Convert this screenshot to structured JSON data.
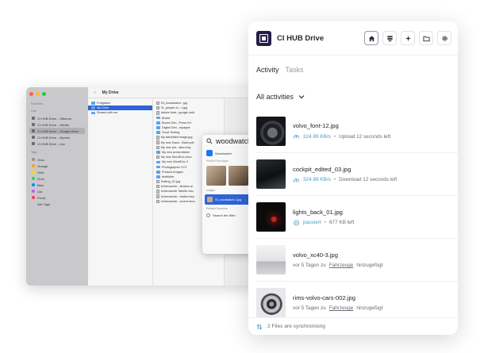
{
  "finder": {
    "toolbar_title": "My Drive",
    "sidebar": {
      "favorites_heading": "Favoriten",
      "locations_heading": "Orte",
      "tags_heading": "Tags",
      "locations": [
        "CI HUB Drive – Sitecore",
        "CI HUB Drive – Wedia",
        "CI HUB Drive – Google Drive",
        "CI HUB Drive – Bynder",
        "CI HUB Drive – box"
      ],
      "tags": [
        {
          "label": "Grau",
          "color": "#8e8e93"
        },
        {
          "label": "Orange",
          "color": "#ff9f0a"
        },
        {
          "label": "Gelb",
          "color": "#ffd60a"
        },
        {
          "label": "Grün",
          "color": "#30d158"
        },
        {
          "label": "Blau",
          "color": "#0a84ff"
        },
        {
          "label": "Lila",
          "color": "#bf5af2"
        },
        {
          "label": "Privat",
          "color": "#ff375f"
        },
        {
          "label": "Alle Tags",
          "color": "#c7c7cc"
        }
      ]
    },
    "column1": [
      "Freigaben",
      "My Drive",
      "Shared with me"
    ],
    "column2": [
      "03_woodwatch...jpg",
      "01_people-in-...t.jpg",
      "Adobe-Inde...google.indd",
      "Brand",
      "Brand Gen...Press Kit",
      "Digital Gen...mpagne",
      "Good Testing",
      "My wieddded image.jpg",
      "My new Dwcu...Bank.pdf",
      "My new pre...ation.key",
      "My new presentation",
      "My new WordDoc.docx",
      "My new WordDoc 2",
      "Photographer XYZ",
      "Product-Images",
      "testfolder",
      "Testing_01.jpg",
      "Unbenannte...stration.ai",
      "Unbenannte Tabelle.xlsx",
      "Unbenannte...ntation.key",
      "Unbenannte...ument.docx"
    ],
    "spotlight": {
      "query": "woodwatch",
      "result_title": "Woodwatch",
      "photos_label": "Photos From Apps",
      "images_label": "Images",
      "hit_label": "03_woodwatch-1.jpg",
      "related_label": "Related Searches",
      "search_web": "Search the Web"
    }
  },
  "panel": {
    "app_title": "CI HUB Drive",
    "header_icons": [
      "home-icon",
      "stack-icon",
      "sparkle-icon",
      "folder-icon",
      "gear-icon"
    ],
    "tabs": [
      {
        "label": "Activity",
        "active": true
      },
      {
        "label": "Tasks",
        "active": false
      }
    ],
    "filter_label": "All activities",
    "accent_color": "#4a9abf",
    "items": [
      {
        "filename": "volvo_font-12.jpg",
        "kind": "upload",
        "speed": "324.89 KB/s",
        "sep": "•",
        "detail": "Upload 12 seconds left"
      },
      {
        "filename": "cockpit_edited_03.jpg",
        "kind": "download",
        "speed": "324.89 KB/s",
        "sep": "•",
        "detail": "Download 12 seconds left"
      },
      {
        "filename": "lights_back_01.jpg",
        "kind": "paused",
        "speed": "pausiert",
        "sep": "•",
        "detail": "677 KB left"
      },
      {
        "filename": "volvo_xc40-3.jpg",
        "kind": "added",
        "prefix": "vor 5 Tagen zu",
        "link": "Fahrzeuge",
        "suffix": "hinzugefügt"
      },
      {
        "filename": "rims-volvo-cars-002.jpg",
        "kind": "added",
        "prefix": "vor 5 Tagen zu",
        "link": "Fahrzeuge",
        "suffix": "hinzugefügt"
      }
    ],
    "footer": "2 Files are synchronising"
  }
}
